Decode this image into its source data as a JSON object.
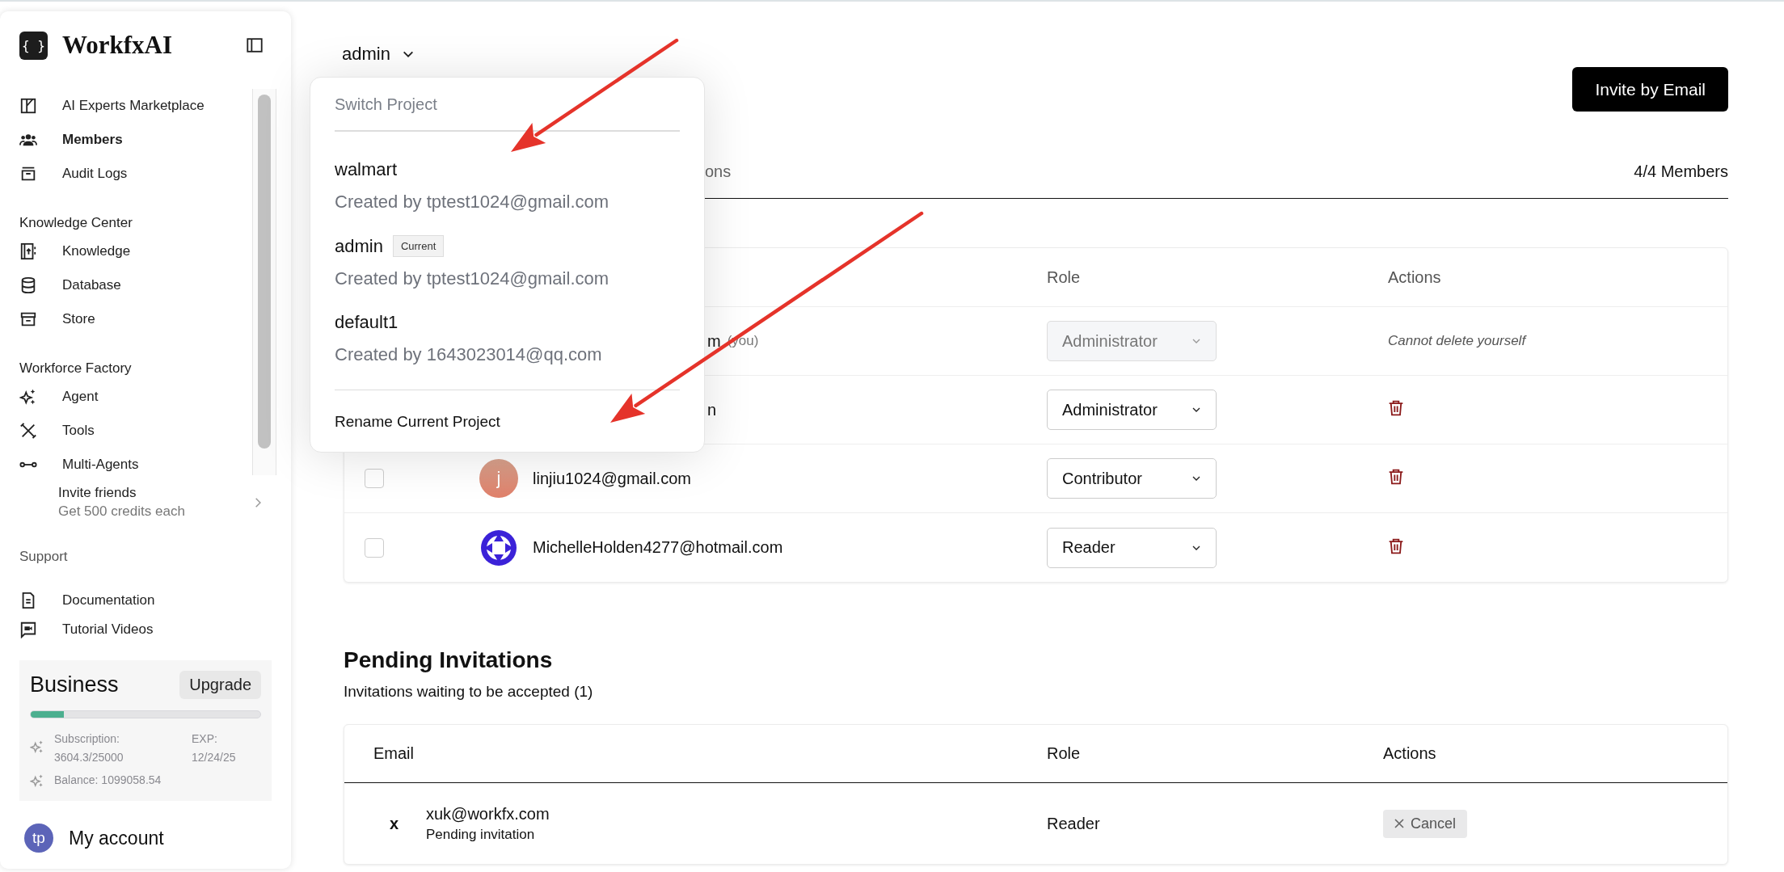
{
  "sidebar": {
    "logo_glyph": "{ }",
    "brand": "WorkfxAI",
    "sections": [
      {
        "items": [
          {
            "label": "AI Experts Marketplace",
            "selected": false
          },
          {
            "label": "Members",
            "selected": true
          },
          {
            "label": "Audit Logs",
            "selected": false
          }
        ]
      },
      {
        "title": "Knowledge Center",
        "items": [
          {
            "label": "Knowledge",
            "selected": false
          },
          {
            "label": "Database",
            "selected": false
          },
          {
            "label": "Store",
            "selected": false
          }
        ]
      },
      {
        "title": "Workforce Factory",
        "items": [
          {
            "label": "Agent",
            "selected": false
          },
          {
            "label": "Tools",
            "selected": false
          },
          {
            "label": "Multi-Agents",
            "selected": false
          }
        ]
      }
    ],
    "invite": {
      "title": "Invite friends",
      "subtitle": "Get 500 credits each"
    },
    "support": {
      "title": "Support",
      "items": [
        {
          "label": "Documentation"
        },
        {
          "label": "Tutorial Videos"
        }
      ]
    },
    "plan": {
      "name": "Business",
      "upgrade": "Upgrade",
      "level": 0.144,
      "subscription_label": "Subscription:",
      "subscription_value": "3604.3/25000",
      "exp_label": "EXP:",
      "exp_value": "12/24/25",
      "balance": "Balance: 1099058.54"
    },
    "account": {
      "initials": "tp",
      "label": "My account"
    }
  },
  "header": {
    "project": "admin",
    "invite_button": "Invite by Email"
  },
  "tabs": [
    {
      "label": "ons",
      "selected": false
    }
  ],
  "member_count": "4/4 Members",
  "members": {
    "columns": [
      "Role",
      "Actions"
    ],
    "rows": [
      {
        "email": "m",
        "note": "(you)",
        "role": "Administrator",
        "role_disabled": true,
        "action": "Cannot delete yourself"
      },
      {
        "email": "n",
        "role": "Administrator",
        "role_disabled": false,
        "deletable": true
      },
      {
        "checked": false,
        "avatar": {
          "kind": "letter",
          "text": "j"
        },
        "email": "linjiu1024@gmail.com",
        "role": "Contributor",
        "role_disabled": false,
        "deletable": true
      },
      {
        "checked": false,
        "avatar": {
          "kind": "pattern"
        },
        "email": "MichelleHolden4277@hotmail.com",
        "role": "Reader",
        "role_disabled": false,
        "deletable": true
      }
    ]
  },
  "pending": {
    "title": "Pending Invitations",
    "subtitle": "Invitations waiting to be accepted (1)",
    "columns": [
      "Email",
      "Role",
      "Actions"
    ],
    "rows": [
      {
        "mark": "x",
        "email": "xuk@workfx.com",
        "status": "Pending invitation",
        "role": "Reader",
        "cancel": "Cancel"
      }
    ]
  },
  "project_menu": {
    "title": "Switch Project",
    "projects": [
      {
        "name": "walmart",
        "creator": "Created by tptest1024@gmail.com"
      },
      {
        "name": "admin",
        "badge": "Current",
        "creator": "Created by tptest1024@gmail.com"
      },
      {
        "name": "default1",
        "creator": "Created by 1643023014@qq.com"
      }
    ],
    "rename": "Rename Current Project"
  }
}
